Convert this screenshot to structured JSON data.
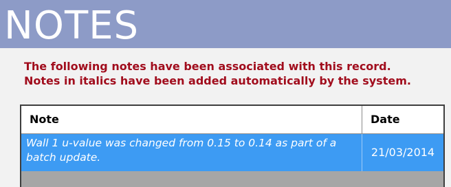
{
  "header": {
    "title": "NOTES"
  },
  "intro": {
    "line1": "The following notes have been associated with this record.",
    "line2": "Notes in italics have been added automatically by the system."
  },
  "table": {
    "columns": {
      "note": "Note",
      "date": "Date"
    },
    "rows": [
      {
        "note": "Wall 1 u-value was changed from 0.15 to 0.14 as part of a batch update.",
        "date": "21/03/2014",
        "italic": true,
        "selected": true
      }
    ]
  },
  "colors": {
    "header_band": "#8d9bc7",
    "intro_text": "#a10d1d",
    "selected_row": "#3d9bf3",
    "empty_area": "#a6a6a6"
  }
}
